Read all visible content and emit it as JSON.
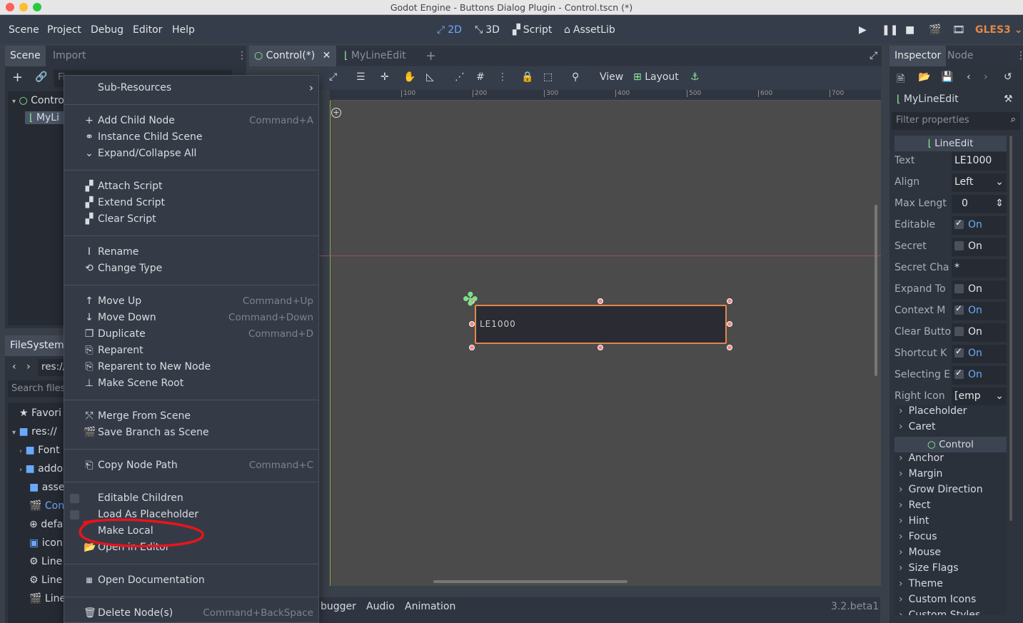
{
  "window": {
    "title": "Godot Engine - Buttons Dialog Plugin - Control.tscn (*)"
  },
  "menubar": {
    "items": [
      "Scene",
      "Project",
      "Debug",
      "Editor",
      "Help"
    ],
    "modes": [
      {
        "icon": "2d-icon",
        "label": "2D"
      },
      {
        "icon": "3d-icon",
        "label": "3D"
      },
      {
        "icon": "script-icon",
        "label": "Script"
      },
      {
        "icon": "assetlib-icon",
        "label": "AssetLib"
      }
    ],
    "renderer": "GLES3"
  },
  "scene_dock": {
    "tabs": [
      "Scene",
      "Import"
    ],
    "filter_placeholder": "Fi",
    "tree": [
      {
        "label": "Contro",
        "icon": "control-icon"
      },
      {
        "label": "MyLi",
        "icon": "lineedit-icon"
      }
    ]
  },
  "filesystem_dock": {
    "tab": "FileSystem",
    "path": "res://",
    "search_placeholder": "Search files",
    "items": [
      {
        "label": "Favori",
        "icon": "star-icon"
      },
      {
        "label": "res://",
        "icon": "folder-icon"
      },
      {
        "label": "Font",
        "icon": "folder-icon"
      },
      {
        "label": "addo",
        "icon": "folder-icon"
      },
      {
        "label": "asse",
        "icon": "folder-icon"
      },
      {
        "label": "Cont",
        "icon": "scene-icon"
      },
      {
        "label": "defa",
        "icon": "globe-icon"
      },
      {
        "label": "icon.",
        "icon": "image-icon"
      },
      {
        "label": "Line",
        "icon": "gear-icon"
      },
      {
        "label": "Line",
        "icon": "gear-icon"
      },
      {
        "label": "Line",
        "icon": "scene-icon"
      }
    ]
  },
  "editor_tabs": [
    {
      "label": "Control(*)",
      "icon": "control-icon"
    },
    {
      "label": "MyLineEdit",
      "icon": "lineedit-icon"
    }
  ],
  "toolbar": {
    "view": "View",
    "layout": "Layout"
  },
  "ruler": [
    "100",
    "200",
    "300",
    "400",
    "500",
    "600",
    "700"
  ],
  "viewport": {
    "lineedit_text": "LE1000"
  },
  "context_menu": {
    "groups": [
      [
        {
          "label": "Sub-Resources",
          "icon": "",
          "shortcut": "",
          "submenu": true
        }
      ],
      [
        {
          "label": "Add Child Node",
          "icon": "plus-icon",
          "shortcut": "Command+A"
        },
        {
          "label": "Instance Child Scene",
          "icon": "link-icon",
          "shortcut": ""
        },
        {
          "label": "Expand/Collapse All",
          "icon": "chevron-down-icon",
          "shortcut": ""
        }
      ],
      [
        {
          "label": "Attach Script",
          "icon": "script-add-icon",
          "shortcut": ""
        },
        {
          "label": "Extend Script",
          "icon": "script-extend-icon",
          "shortcut": ""
        },
        {
          "label": "Clear Script",
          "icon": "script-remove-icon",
          "shortcut": ""
        }
      ],
      [
        {
          "label": "Rename",
          "icon": "rename-icon",
          "shortcut": ""
        },
        {
          "label": "Change Type",
          "icon": "rotate-icon",
          "shortcut": ""
        }
      ],
      [
        {
          "label": "Move Up",
          "icon": "arrow-up-icon",
          "shortcut": "Command+Up"
        },
        {
          "label": "Move Down",
          "icon": "arrow-down-icon",
          "shortcut": "Command+Down"
        },
        {
          "label": "Duplicate",
          "icon": "duplicate-icon",
          "shortcut": "Command+D"
        },
        {
          "label": "Reparent",
          "icon": "reparent-icon",
          "shortcut": ""
        },
        {
          "label": "Reparent to New Node",
          "icon": "reparent-new-icon",
          "shortcut": ""
        },
        {
          "label": "Make Scene Root",
          "icon": "scene-root-icon",
          "shortcut": ""
        }
      ],
      [
        {
          "label": "Merge From Scene",
          "icon": "merge-icon",
          "shortcut": ""
        },
        {
          "label": "Save Branch as Scene",
          "icon": "save-branch-icon",
          "shortcut": ""
        }
      ],
      [
        {
          "label": "Copy Node Path",
          "icon": "copy-icon",
          "shortcut": "Command+C"
        }
      ],
      [
        {
          "label": "Editable Children",
          "icon": "",
          "shortcut": "",
          "checkbox": true
        },
        {
          "label": "Load As Placeholder",
          "icon": "",
          "shortcut": "",
          "checkbox": true
        },
        {
          "label": "Make Local",
          "icon": "",
          "shortcut": ""
        },
        {
          "label": "Open in Editor",
          "icon": "folder-open-icon",
          "shortcut": ""
        }
      ],
      [
        {
          "label": "Open Documentation",
          "icon": "docs-icon",
          "shortcut": ""
        }
      ],
      [
        {
          "label": "Delete Node(s)",
          "icon": "trash-icon",
          "shortcut": "Command+BackSpace"
        }
      ]
    ]
  },
  "inspector": {
    "tabs": [
      "Inspector",
      "Node"
    ],
    "object": "MyLineEdit",
    "filter_placeholder": "Filter properties",
    "class_header": "LineEdit",
    "properties": [
      {
        "key": "Text",
        "value": "LE1000",
        "kind": "text"
      },
      {
        "key": "Align",
        "value": "Left",
        "kind": "dropdown"
      },
      {
        "key": "Max Lengt",
        "value": "0",
        "kind": "spin"
      },
      {
        "key": "Editable",
        "value": "On",
        "kind": "check",
        "checked": true
      },
      {
        "key": "Secret",
        "value": "On",
        "kind": "check",
        "checked": false
      },
      {
        "key": "Secret Cha",
        "value": "*",
        "kind": "text"
      },
      {
        "key": "Expand To",
        "value": "On",
        "kind": "check",
        "checked": false
      },
      {
        "key": "Context M",
        "value": "On",
        "kind": "check",
        "checked": true
      },
      {
        "key": "Clear Butto",
        "value": "On",
        "kind": "check",
        "checked": false
      },
      {
        "key": "Shortcut K",
        "value": "On",
        "kind": "check",
        "checked": true
      },
      {
        "key": "Selecting E",
        "value": "On",
        "kind": "check",
        "checked": true
      },
      {
        "key": "Right Icon",
        "value": "[emp",
        "kind": "dropdown"
      }
    ],
    "sections_a": [
      "Placeholder",
      "Caret"
    ],
    "control_header": "Control",
    "sections_b": [
      "Anchor",
      "Margin",
      "Grow Direction",
      "Rect",
      "Hint",
      "Focus",
      "Mouse",
      "Size Flags",
      "Theme",
      "Custom Icons",
      "Custom Styles"
    ]
  },
  "bottom_panel": {
    "tabs": [
      "bugger",
      "Audio",
      "Animation"
    ],
    "version": "3.2.beta1"
  },
  "colors": {
    "accent": "#6aa9ff",
    "annotation": "#e8141e",
    "selection": "#e0884a"
  }
}
